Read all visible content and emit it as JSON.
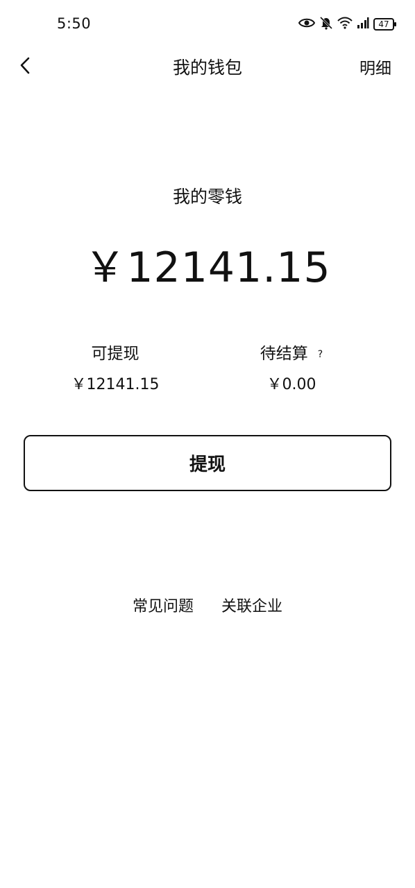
{
  "status_bar": {
    "time": "5:50",
    "icons": [
      "eye-icon",
      "bell-muted-icon",
      "wifi-icon",
      "signal-icon"
    ],
    "battery": "47"
  },
  "nav": {
    "back_icon": "chevron-left-icon",
    "title": "我的钱包",
    "detail_label": "明细"
  },
  "balance": {
    "label": "我的零钱",
    "amount": "￥12141.15"
  },
  "withdrawable": {
    "label": "可提现",
    "value": "￥12141.15"
  },
  "pending": {
    "label": "待结算",
    "help": "?",
    "value": "￥0.00"
  },
  "actions": {
    "withdraw_label": "提现"
  },
  "footer": {
    "faq_label": "常见问题",
    "linked_company_label": "关联企业"
  }
}
